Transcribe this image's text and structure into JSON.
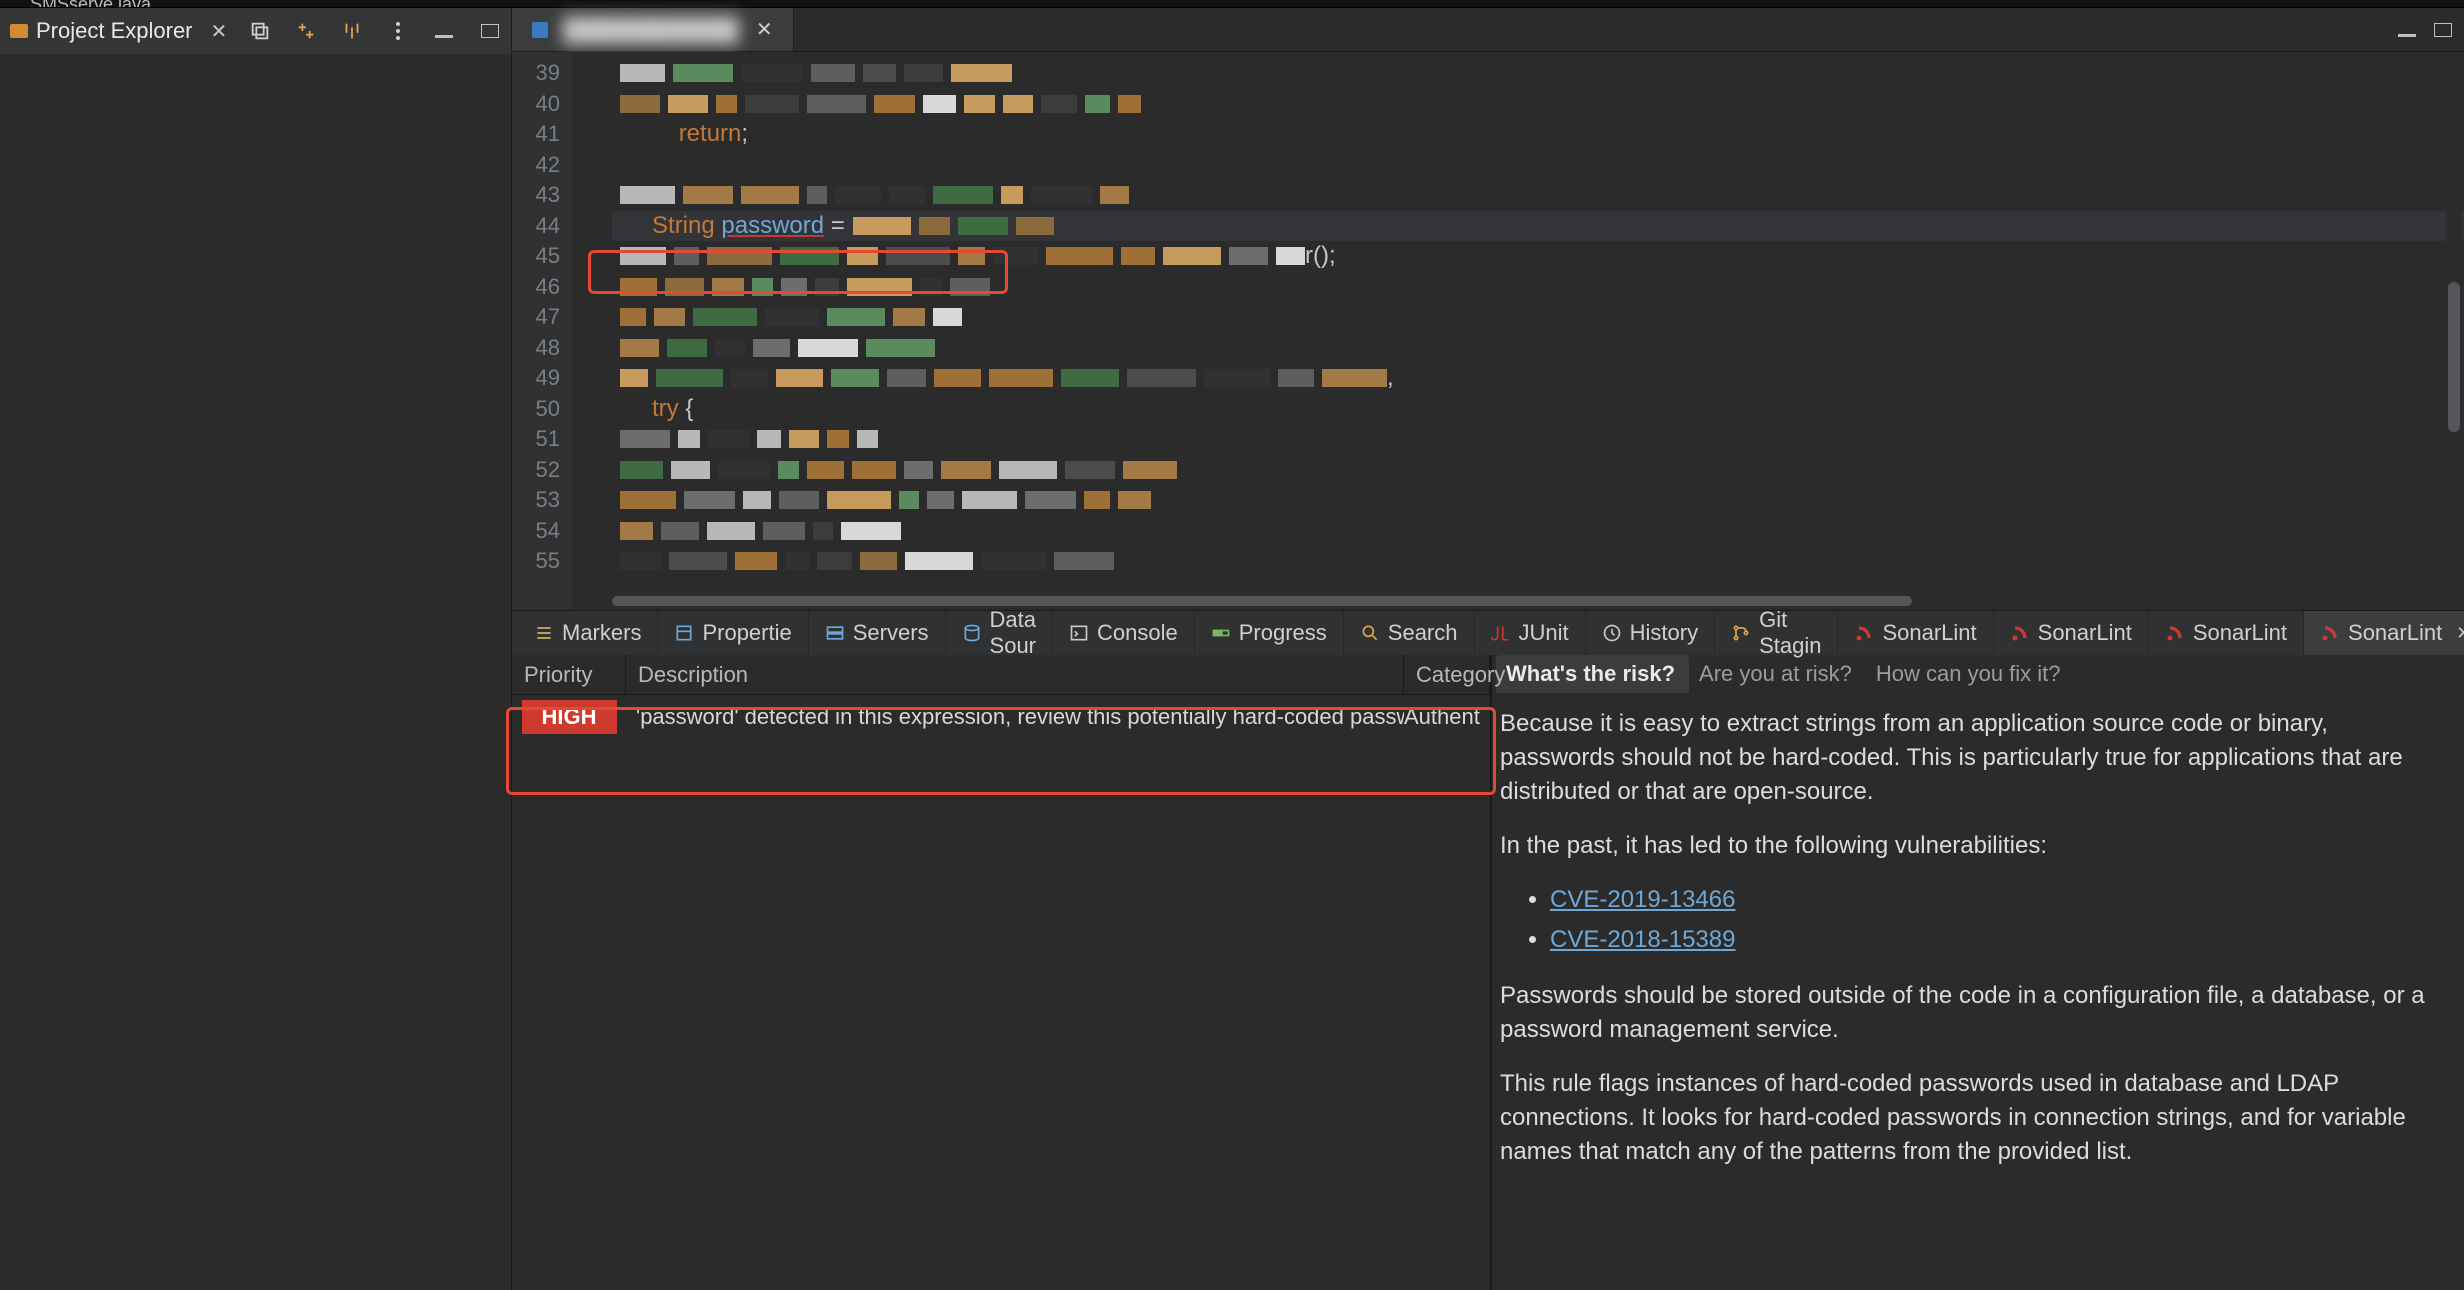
{
  "title_file": "SMSserve.java",
  "sidebar": {
    "title": "Project Explorer"
  },
  "editor": {
    "tab_name": "██████████",
    "line_start": 39,
    "lines": [
      {
        "n": 39,
        "mosaic": true
      },
      {
        "n": 40,
        "mosaic": true
      },
      {
        "n": 41,
        "tokens": [
          {
            "t": "          ",
            "c": ""
          },
          {
            "t": "return",
            "c": "kwret"
          },
          {
            "t": ";",
            "c": ""
          }
        ]
      },
      {
        "n": 42,
        "tokens": []
      },
      {
        "n": 43,
        "mosaic": true
      },
      {
        "n": 44,
        "hl": true,
        "tokens": [
          {
            "t": "      ",
            "c": ""
          },
          {
            "t": "String",
            "c": "kw"
          },
          {
            "t": " ",
            "c": ""
          },
          {
            "t": "password",
            "c": "ident-link"
          },
          {
            "t": " =",
            "c": "eq"
          }
        ],
        "mosaic_tail": true
      },
      {
        "n": 45,
        "mosaic": true,
        "suffix": "r();"
      },
      {
        "n": 46,
        "mosaic": true
      },
      {
        "n": 47,
        "mosaic": true
      },
      {
        "n": 48,
        "mosaic": true
      },
      {
        "n": 49,
        "mosaic": true,
        "suffix": ","
      },
      {
        "n": 50,
        "tokens": [
          {
            "t": "      ",
            "c": ""
          },
          {
            "t": "try",
            "c": "kw"
          },
          {
            "t": " {",
            "c": ""
          }
        ]
      },
      {
        "n": 51,
        "mosaic": true
      },
      {
        "n": 52,
        "mosaic": true
      },
      {
        "n": 53,
        "mosaic": true
      },
      {
        "n": 54,
        "mosaic": true
      },
      {
        "n": 55,
        "mosaic": true
      }
    ]
  },
  "view_tabs": [
    {
      "icon": "list",
      "label": "Markers"
    },
    {
      "icon": "props",
      "label": "Propertie"
    },
    {
      "icon": "server",
      "label": "Servers"
    },
    {
      "icon": "db",
      "label": "Data Sour"
    },
    {
      "icon": "console",
      "label": "Console"
    },
    {
      "icon": "progress",
      "label": "Progress"
    },
    {
      "icon": "search",
      "label": "Search"
    },
    {
      "icon": "junit",
      "label": "JUnit"
    },
    {
      "icon": "history",
      "label": "History"
    },
    {
      "icon": "git",
      "label": "Git Stagin"
    },
    {
      "icon": "sonar",
      "label": "SonarLint"
    },
    {
      "icon": "sonar",
      "label": "SonarLint"
    },
    {
      "icon": "sonar",
      "label": "SonarLint"
    },
    {
      "icon": "sonar",
      "label": "SonarLint",
      "active": true,
      "close": true
    }
  ],
  "issues": {
    "cols": {
      "priority": "Priority",
      "description": "Description",
      "category": "Category"
    },
    "rows": [
      {
        "priority": "HIGH",
        "description": "'password' detected in this expression, review this potentially hard-coded password.",
        "category": "Authent"
      }
    ]
  },
  "details": {
    "tabs": [
      "What's the risk?",
      "Are you at risk?",
      "How can you fix it?"
    ],
    "active_tab": 0,
    "para1": "Because it is easy to extract strings from an application source code or binary, passwords should not be hard-coded. This is particularly true for applications that are distributed or that are open-source.",
    "para2": "In the past, it has led to the following vulnerabilities:",
    "cves": [
      "CVE-2019-13466",
      "CVE-2018-15389"
    ],
    "para3": "Passwords should be stored outside of the code in a configuration file, a database, or a password management service.",
    "para4": "This rule flags instances of hard-coded passwords used in database and LDAP connections. It looks for hard-coded passwords in connection strings, and for variable names that match any of the patterns from the provided list."
  }
}
